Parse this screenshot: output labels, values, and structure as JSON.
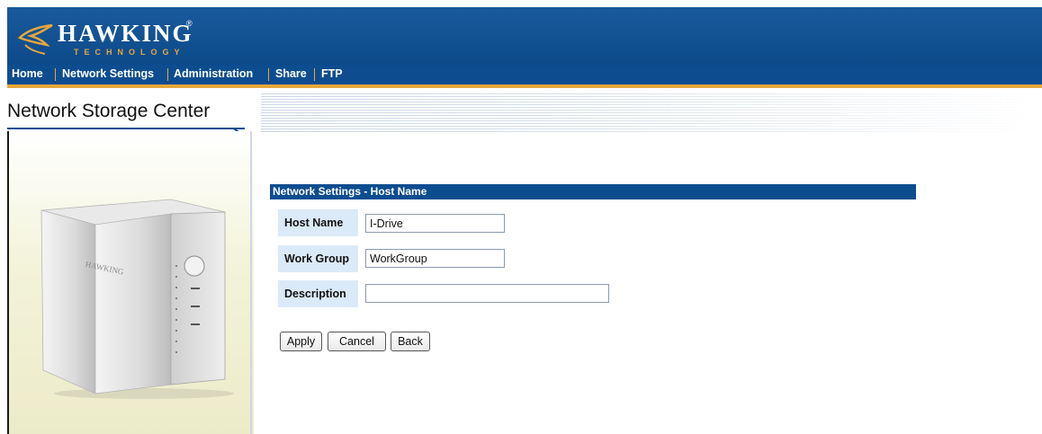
{
  "brand": {
    "name": "HAWKING",
    "registered": "®",
    "subtitle": "TECHNOLOGY"
  },
  "nav": {
    "items": [
      "Home",
      "Network Settings",
      "Administration",
      "Share",
      "FTP"
    ]
  },
  "page": {
    "title": "Network Storage Center"
  },
  "device": {
    "label": "HAWKING"
  },
  "form": {
    "heading": "Network Settings - Host Name",
    "host_name": {
      "label": "Host Name",
      "value": "I-Drive"
    },
    "work_group": {
      "label": "Work Group",
      "value": "WorkGroup"
    },
    "description": {
      "label": "Description",
      "value": ""
    },
    "buttons": {
      "apply": "Apply",
      "cancel": "Cancel",
      "back": "Back"
    }
  },
  "colors": {
    "brand_blue": "#0d4d8f",
    "accent_orange": "#e8a63a",
    "label_bg": "#dbeaf8"
  }
}
